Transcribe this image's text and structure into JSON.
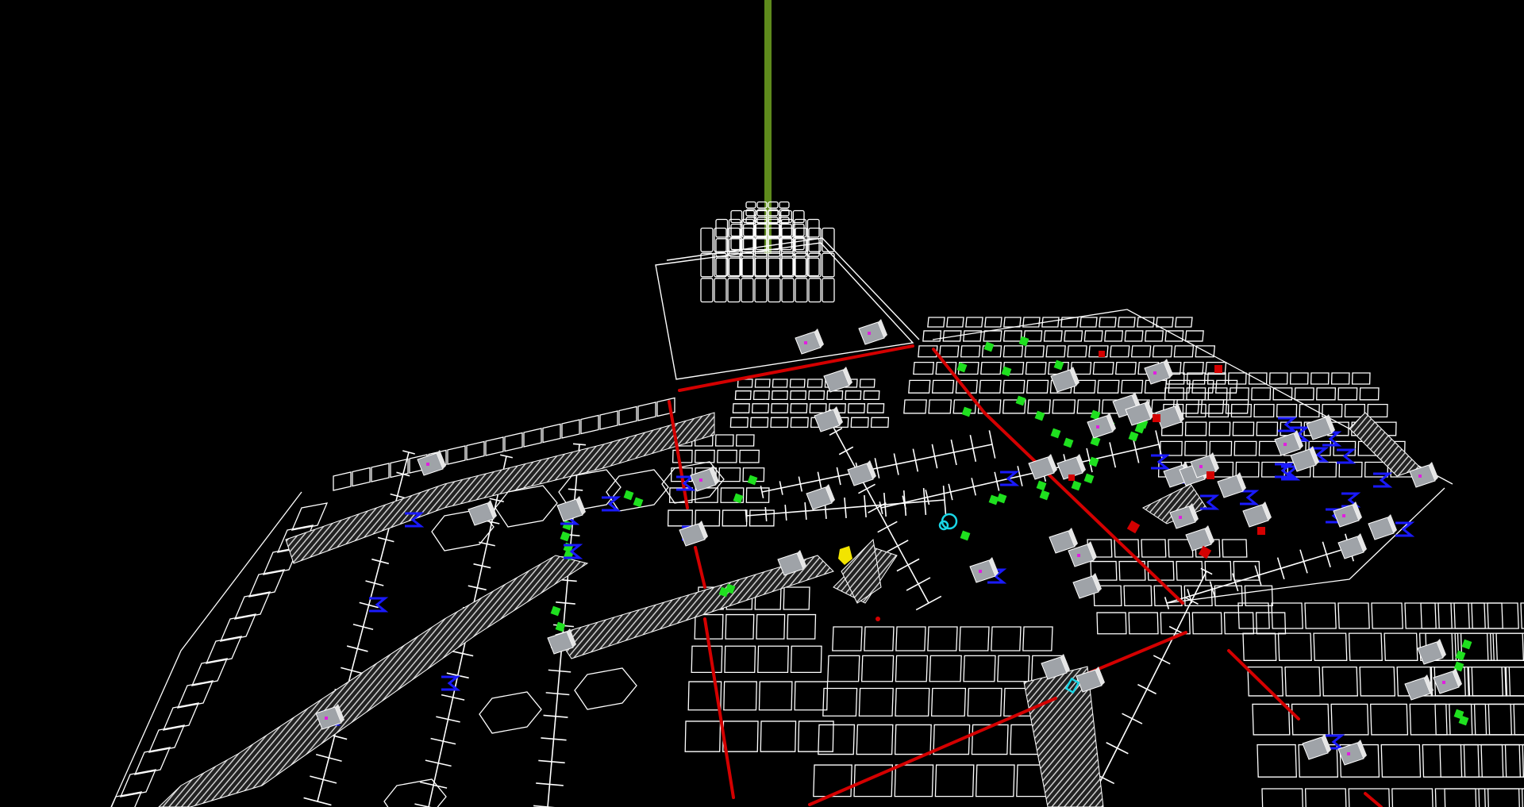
{
  "scene": {
    "name": "wireframe-3d-level-view",
    "background": "#000000",
    "colors": {
      "wire": "#ffffff",
      "beam": "#5e8a1c",
      "red_line": "#d40000",
      "blue_marker": "#1a1aff",
      "green_marker": "#1fe01f",
      "cyan_marker": "#19d6e6",
      "yellow_marker": "#f2e400",
      "magenta_marker": "#e01ee0",
      "hatch": "#bdbdbd",
      "panel": "#9fa3a8"
    },
    "objects": [
      {
        "name": "spawn-beam",
        "kind": "vertical-beam"
      },
      {
        "name": "central-tower",
        "kind": "stepped-pyramid"
      },
      {
        "name": "floor-grid",
        "kind": "tile-grid"
      },
      {
        "name": "hatched-walkways",
        "kind": "striped-ramp"
      },
      {
        "name": "red-laser-lines",
        "kind": "hazard-line"
      },
      {
        "name": "green-pickups",
        "kind": "item-marker"
      },
      {
        "name": "blue-spawn-markers",
        "kind": "entity-marker"
      },
      {
        "name": "yellow-key-marker",
        "kind": "entity-marker"
      },
      {
        "name": "cyan-teleporter-markers",
        "kind": "entity-marker"
      }
    ]
  }
}
